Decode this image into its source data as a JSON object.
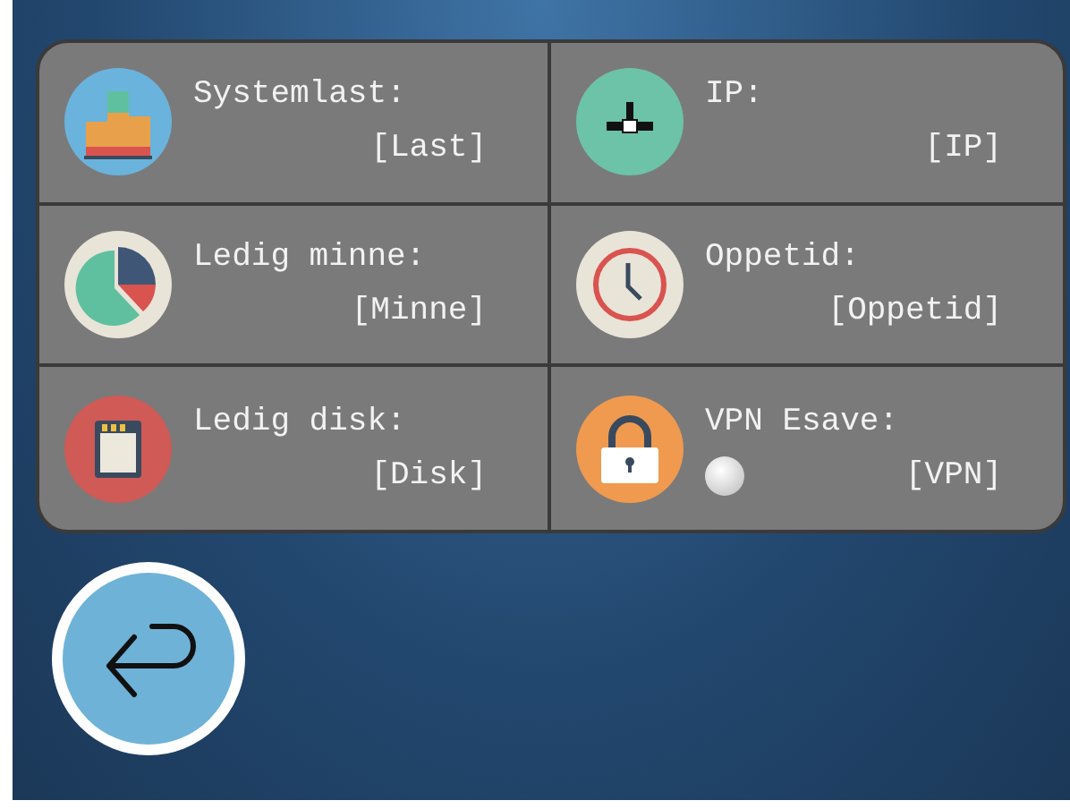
{
  "tiles": [
    {
      "kind": "load",
      "label": "Systemlast:",
      "value": "[Last]"
    },
    {
      "kind": "network",
      "label": "IP:",
      "value": "[IP]"
    },
    {
      "kind": "memory",
      "label": "Ledig minne:",
      "value": "[Minne]"
    },
    {
      "kind": "clock",
      "label": "Oppetid:",
      "value": "[Oppetid]"
    },
    {
      "kind": "disk",
      "label": "Ledig disk:",
      "value": "[Disk]"
    },
    {
      "kind": "lock",
      "label": "VPN Esave:",
      "value": "[VPN]",
      "status_light": {
        "on": false
      }
    }
  ],
  "back_button": {
    "kind": "return"
  }
}
